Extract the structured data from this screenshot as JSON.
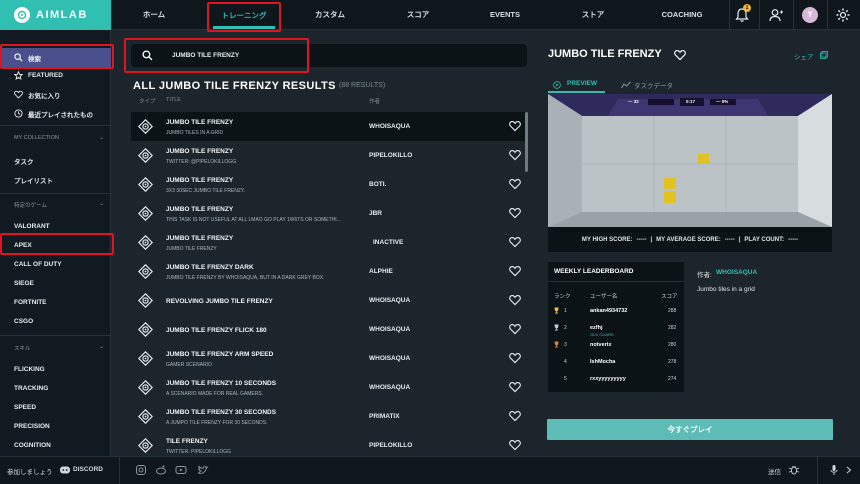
{
  "app": {
    "logo_text": "AIMLAB"
  },
  "nav": {
    "items": [
      "ホーム",
      "トレーニング",
      "カスタム",
      "スコア",
      "EVENTS",
      "ストア",
      "COACHING"
    ],
    "notification_count": "1",
    "avatar_letter": "Y"
  },
  "sidebar": {
    "top_items": [
      "検索",
      "FEATURED",
      "お気に入り",
      "最近プレイされたもの"
    ],
    "collection_header": "MY COLLECTION",
    "collection_items": [
      "タスク",
      "プレイリスト"
    ],
    "games_header": "特定のゲーム",
    "games": [
      "VALORANT",
      "APEX",
      "CALL OF DUTY",
      "SIEGE",
      "FORTNITE",
      "CSGO"
    ],
    "skills_header": "スキル",
    "skills": [
      "FLICKING",
      "TRACKING",
      "SPEED",
      "PRECISION",
      "COGNITION"
    ]
  },
  "bottom": {
    "join_text": "参加しましょう",
    "discord_label": "DISCORD",
    "send_label": "送信"
  },
  "search": {
    "query": "JUMBO TILE FRENZY"
  },
  "results": {
    "title": "ALL JUMBO TILE FRENZY RESULTS",
    "count": "(88 RESULTS)",
    "columns": {
      "type": "タイプ",
      "title": "TITLE",
      "author": "作者"
    },
    "rows": [
      {
        "title": "JUMBO TILE FRENZY",
        "subtitle": "JUMBO TILES IN A GRID",
        "author": "WHOISAQUA"
      },
      {
        "title": "JUMBO TILE FRENZY",
        "subtitle": "TWITTER: @PIPELOKILLOGG",
        "author": "PIPELOKILLO"
      },
      {
        "title": "JUMBO TILE FRENZY",
        "subtitle": "3X3 30SEC JUMBO TILE FRENZY.",
        "author": "BOTI."
      },
      {
        "title": "JUMBO TILE FRENZY",
        "subtitle": "THIS TASK IS NOT USEFUL AT ALL LMAO GO PLAY 1W6TS OR SOMETHI...",
        "author": "JBR"
      },
      {
        "title": "JUMBO TILE FRENZY",
        "subtitle": "JUMBO TILE FRENZY",
        "author": "INACTIVE"
      },
      {
        "title": "JUMBO TILE FRENZY DARK",
        "subtitle": "JUMBO TILE FRENZY BY WHOISAQUA, BUT IN A DARK GREY BOX.",
        "author": "ALPHIE"
      },
      {
        "title": "REVOLVING JUMBO TILE FRENZY",
        "subtitle": "",
        "author": "WHOISAQUA"
      },
      {
        "title": "JUMBO TILE FRENZY FLICK 180",
        "subtitle": "",
        "author": "WHOISAQUA"
      },
      {
        "title": "JUMBO TILE FRENZY ARM SPEED",
        "subtitle": "GAMER SCENARIO",
        "author": "WHOISAQUA"
      },
      {
        "title": "JUMBO TILE FRENZY 10 SECONDS",
        "subtitle": "A SCENARIO MADE FOR REAL GAMERS.",
        "author": "WHOISAQUA"
      },
      {
        "title": "JUMBO TILE FRENZY 30 SECONDS",
        "subtitle": "A JUMPO TILE FRENZY FOR 30 SECONDS.",
        "author": "PRIMATIX"
      },
      {
        "title": "TILE FRENZY",
        "subtitle": "TWITTER: PIPELOKILLOGG",
        "author": "PIPELOKILLO"
      }
    ]
  },
  "detail": {
    "title": "JUMBO TILE FRENZY",
    "share_label": "シェア",
    "tabs": [
      "PREVIEW",
      "タスクデータ"
    ],
    "hud": {
      "left": "— 32",
      "center": "0:17",
      "right": "— 0%"
    },
    "stats": {
      "high_score_label": "MY HIGH SCORE:",
      "high_score": "-----",
      "avg_label": "MY AVERAGE SCORE:",
      "avg": "-----",
      "play_label": "PLAY COUNT:",
      "play": "-----"
    },
    "leaderboard": {
      "title": "WEEKLY LEADERBOARD",
      "headers": [
        "ランク",
        "ユーザー名",
        "スコア"
      ],
      "rows": [
        {
          "rank": "1",
          "user": "ankan4934732",
          "sub": "",
          "score": "288"
        },
        {
          "rank": "2",
          "user": "ezfhj",
          "sub": "OLD GUARD",
          "score": "282"
        },
        {
          "rank": "3",
          "user": "notverix",
          "sub": "",
          "score": "280"
        },
        {
          "rank": "4",
          "user": "IshMocha",
          "sub": "",
          "score": "278"
        },
        {
          "rank": "5",
          "user": "rxxyyyyyyyyy",
          "sub": "",
          "score": "274"
        }
      ]
    },
    "author_label": "作者:",
    "author": "WHOISAQUA",
    "description": "Jumbo tiles in a grid",
    "play_button": "今すぐプレイ"
  },
  "colors": {
    "accent": "#31bfb2",
    "highlight_box": "#e0141e",
    "search_active": "#4b4f8c"
  }
}
